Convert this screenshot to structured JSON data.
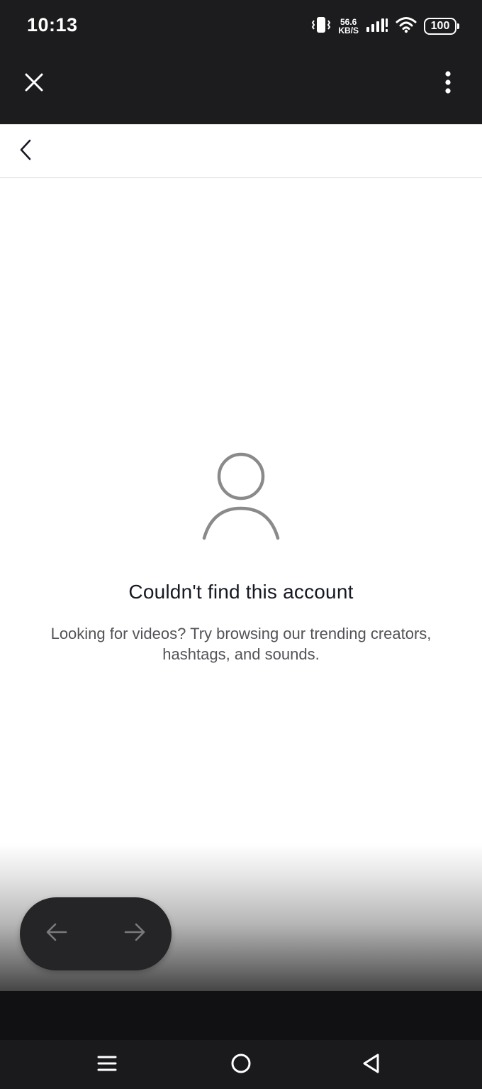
{
  "status_bar": {
    "time": "10:13",
    "net_speed_value": "56.6",
    "net_speed_unit": "KB/S",
    "battery": "100",
    "icons": [
      "vibrate-icon",
      "signal-icon",
      "wifi-icon",
      "battery-icon"
    ]
  },
  "toolbar": {
    "icons": [
      "close-icon",
      "more-vertical-icon"
    ]
  },
  "header": {
    "icons": [
      "chevron-left-icon"
    ]
  },
  "empty_state": {
    "icon": "person-icon",
    "title": "Couldn't find this account",
    "description": "Looking for videos? Try browsing our trending creators, hashtags, and sounds."
  },
  "nav_pill": {
    "icons": [
      "arrow-left-icon",
      "arrow-right-icon"
    ]
  },
  "system_nav": {
    "icons": [
      "menu-icon",
      "home-icon",
      "back-icon"
    ]
  },
  "colors": {
    "bar_dark": "#1c1c1e",
    "title_text": "#161823",
    "desc_text": "#525358",
    "icon_gray": "#8a8a8a"
  }
}
